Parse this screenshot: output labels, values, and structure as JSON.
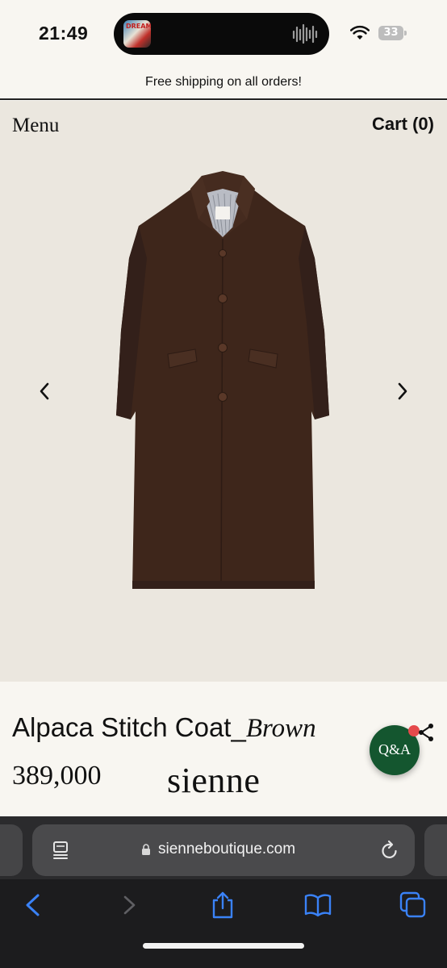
{
  "status_bar": {
    "time": "21:49",
    "battery": "33",
    "now_playing_art_text": "DREAM",
    "icons": [
      "album-art-icon",
      "audio-waveform-icon",
      "wifi-icon",
      "battery-icon"
    ]
  },
  "banner": {
    "text": "Free shipping on all orders!"
  },
  "header": {
    "menu_label": "Menu",
    "cart_label": "Cart (0)"
  },
  "gallery": {
    "icons": [
      "chevron-left-icon",
      "chevron-right-icon"
    ],
    "image_subject": "coat",
    "colors": {
      "background": "#ebe7df",
      "coat": "#3e261b"
    }
  },
  "product": {
    "name": "Alpaca Stitch Coat_",
    "variant": "Brown",
    "price": "389,000",
    "brand": "sienne"
  },
  "widgets": {
    "qa_label": "Q&A",
    "qa_color": "#14562f",
    "notification_dot_color": "#e5494b",
    "icons": [
      "share-icon"
    ]
  },
  "browser": {
    "url": "sienneboutique.com",
    "icons": [
      "page-menu-icon",
      "lock-icon",
      "reload-icon",
      "back-icon",
      "forward-icon",
      "share-icon",
      "bookmarks-icon",
      "tabs-icon"
    ],
    "accent_color": "#3a82f7"
  }
}
